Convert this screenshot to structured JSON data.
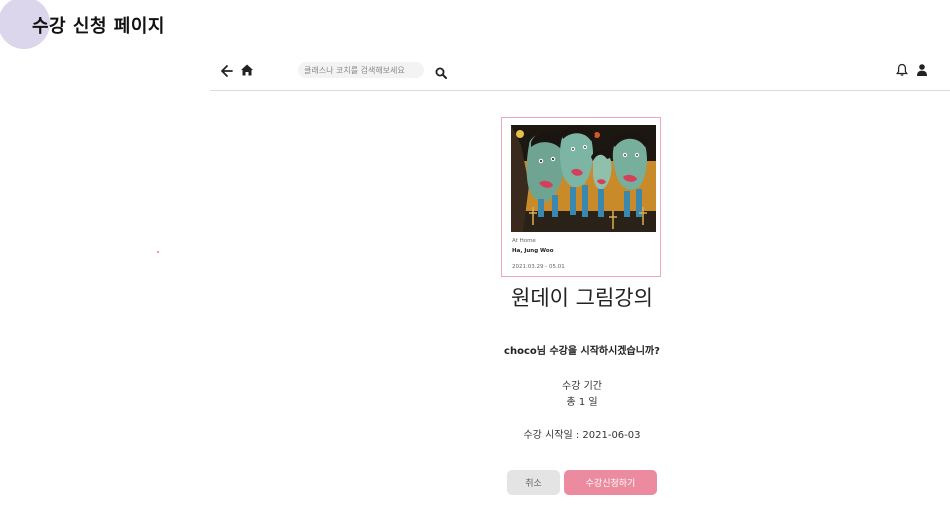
{
  "page": {
    "heading": "수강 신청 페이지"
  },
  "topbar": {
    "search_placeholder": "클래스나 코치를 검색해보세요"
  },
  "card": {
    "subtitle": "At Home",
    "artist": "Ha, Jung Woo",
    "date_range": "2021.03.29 - 05.01"
  },
  "course": {
    "title": "원데이 그림강의",
    "question": "choco님 수강을 시작하시겠습니까?",
    "period_label": "수강 기간",
    "period_value": "총 1 일",
    "start_date": "수강 시작일 : 2021-06-03"
  },
  "actions": {
    "cancel_label": "취소",
    "apply_label": "수강신청하기"
  },
  "colors": {
    "accent": "#ec8aa0",
    "card_border": "#f0a8b8",
    "heading_circle": "#dcd6ec"
  }
}
